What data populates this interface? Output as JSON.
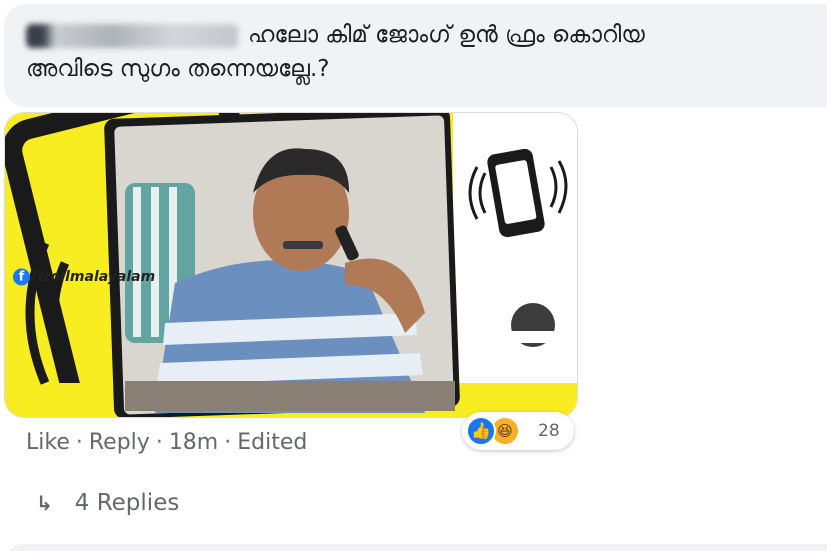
{
  "comment": {
    "text_line1": "ഹലോ കിമ് ജോംഗ് ഉൻ ഫ്രം കൊറിയ",
    "text_line2": "അവിടെ സുഗം തന്നെയല്ലേ.?"
  },
  "media": {
    "page_handle": "/trollmalayalam",
    "colors": {
      "background": "#f7ed21",
      "frame": "#1a1a1a"
    }
  },
  "reactions": {
    "icons": [
      "like-icon",
      "haha-icon"
    ],
    "count": "28"
  },
  "actions": {
    "like": "Like",
    "reply": "Reply",
    "time": "18m",
    "edited": "Edited",
    "separator": "·"
  },
  "replies": {
    "label": "4 Replies",
    "icon": "reply-arrow-icon"
  }
}
